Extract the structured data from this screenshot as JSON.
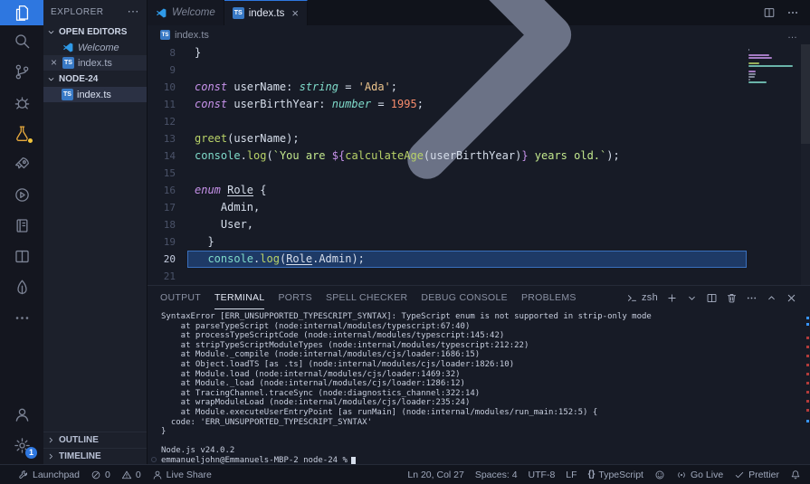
{
  "colors": {
    "accent_blue": "#2e77e0",
    "ts_icon_blue": "#3879c5",
    "flask_orange": "#e8aa3d",
    "badge_yellow": "#f0c33c",
    "error_red": "#b23b3b",
    "info_blue": "#3794ff",
    "selection_blue": "#1e3a66"
  },
  "activity_bar": {
    "top": [
      {
        "name": "explorer",
        "icon": "files",
        "active": true
      },
      {
        "name": "search",
        "icon": "search"
      },
      {
        "name": "source-control",
        "icon": "git-branch"
      },
      {
        "name": "run-debug",
        "icon": "bug"
      },
      {
        "name": "testing",
        "icon": "flask",
        "color": "#e8aa3d",
        "dot": true
      },
      {
        "name": "remote-explorer",
        "icon": "rocket"
      },
      {
        "name": "run",
        "icon": "play-circle"
      },
      {
        "name": "notebook",
        "icon": "book"
      },
      {
        "name": "editor-layout",
        "icon": "columns"
      },
      {
        "name": "mongodb",
        "icon": "leaf"
      },
      {
        "name": "more-views",
        "icon": "ellipsis"
      }
    ],
    "bottom": [
      {
        "name": "accounts",
        "icon": "person"
      },
      {
        "name": "settings",
        "icon": "gear",
        "badge": "1"
      }
    ]
  },
  "sidebar": {
    "title": "EXPLORER",
    "more_actions": "⋯",
    "open_editors": {
      "label": "OPEN EDITORS",
      "items": [
        {
          "label": "Welcome",
          "icon": "vscode",
          "italic": true
        },
        {
          "label": "index.ts",
          "icon": "ts",
          "active": true,
          "close": "×"
        }
      ]
    },
    "folder": {
      "label": "NODE-24",
      "items": [
        {
          "label": "index.ts",
          "icon": "ts",
          "selected": true
        }
      ]
    },
    "bottom_sections": [
      {
        "label": "OUTLINE"
      },
      {
        "label": "TIMELINE"
      }
    ]
  },
  "tab_bar": {
    "tabs": [
      {
        "label": "Welcome",
        "icon": "vscode",
        "italic": true
      },
      {
        "label": "index.ts",
        "icon": "ts",
        "active": true,
        "close": "×"
      }
    ]
  },
  "breadcrumb": {
    "file": "index.ts",
    "ellipsis": "…"
  },
  "editor": {
    "lines": [
      {
        "n": "8",
        "tokens": [
          [
            "fg",
            "}"
          ]
        ]
      },
      {
        "n": "9",
        "tokens": []
      },
      {
        "n": "10",
        "tokens": [
          [
            "kw",
            "const "
          ],
          [
            "vr",
            "userName"
          ],
          [
            "fg",
            ": "
          ],
          [
            "ty",
            "string"
          ],
          [
            "fg",
            " = "
          ],
          [
            "st",
            "'Ada'"
          ],
          [
            "fg",
            ";"
          ]
        ]
      },
      {
        "n": "11",
        "tokens": [
          [
            "kw",
            "const "
          ],
          [
            "vr",
            "userBirthYear"
          ],
          [
            "fg",
            ": "
          ],
          [
            "ty",
            "number"
          ],
          [
            "fg",
            " = "
          ],
          [
            "nu",
            "1995"
          ],
          [
            "fg",
            ";"
          ]
        ]
      },
      {
        "n": "12",
        "tokens": []
      },
      {
        "n": "13",
        "tokens": [
          [
            "fn",
            "greet"
          ],
          [
            "fg",
            "("
          ],
          [
            "vr",
            "userName"
          ],
          [
            "fg",
            ");"
          ]
        ]
      },
      {
        "n": "14",
        "tokens": [
          [
            "ob",
            "console"
          ],
          [
            "fg",
            "."
          ],
          [
            "fn",
            "log"
          ],
          [
            "fg",
            "("
          ],
          [
            "st2",
            "`You are "
          ],
          [
            "kw2",
            "${"
          ],
          [
            "fn",
            "calculateAge"
          ],
          [
            "fg",
            "("
          ],
          [
            "vr",
            "userBirthYear"
          ],
          [
            "fg",
            ")"
          ],
          [
            "kw2",
            "}"
          ],
          [
            "st2",
            " years old.`"
          ],
          [
            "fg",
            ");"
          ]
        ]
      },
      {
        "n": "15",
        "tokens": []
      },
      {
        "n": "16",
        "tokens": [
          [
            "kw",
            "enum "
          ],
          [
            "clu",
            "Role"
          ],
          [
            "fg",
            " {"
          ]
        ]
      },
      {
        "n": "17",
        "tokens": [
          [
            "fg",
            "    Admin,"
          ]
        ]
      },
      {
        "n": "18",
        "tokens": [
          [
            "fg",
            "    User,"
          ]
        ]
      },
      {
        "n": "19",
        "tokens": [
          [
            "fg",
            "  }"
          ]
        ]
      },
      {
        "n": "20",
        "selected": true,
        "tokens": [
          [
            "fg",
            "  "
          ],
          [
            "ob",
            "console"
          ],
          [
            "fg",
            "."
          ],
          [
            "fn",
            "log"
          ],
          [
            "fg",
            "("
          ],
          [
            "clu",
            "Role"
          ],
          [
            "fg",
            "."
          ],
          [
            "en",
            "Admin"
          ],
          [
            "fg",
            ");"
          ]
        ]
      },
      {
        "n": "21",
        "tokens": []
      }
    ]
  },
  "panel": {
    "tabs": [
      {
        "label": "OUTPUT"
      },
      {
        "label": "TERMINAL",
        "active": true
      },
      {
        "label": "PORTS"
      },
      {
        "label": "SPELL CHECKER"
      },
      {
        "label": "DEBUG CONSOLE"
      },
      {
        "label": "PROBLEMS"
      }
    ],
    "shell": "zsh",
    "terminal_lines": [
      "SyntaxError [ERR_UNSUPPORTED_TYPESCRIPT_SYNTAX]: TypeScript enum is not supported in strip-only mode",
      "    at parseTypeScript (node:internal/modules/typescript:67:40)",
      "    at processTypeScriptCode (node:internal/modules/typescript:145:42)",
      "    at stripTypeScriptModuleTypes (node:internal/modules/typescript:212:22)",
      "    at Module._compile (node:internal/modules/cjs/loader:1686:15)",
      "    at Object.loadTS [as .ts] (node:internal/modules/cjs/loader:1826:10)",
      "    at Module.load (node:internal/modules/cjs/loader:1469:32)",
      "    at Module._load (node:internal/modules/cjs/loader:1286:12)",
      "    at TracingChannel.traceSync (node:diagnostics_channel:322:14)",
      "    at wrapModuleLoad (node:internal/modules/cjs/loader:235:24)",
      "    at Module.executeUserEntryPoint [as runMain] (node:internal/modules/run_main:152:5) {",
      "  code: 'ERR_UNSUPPORTED_TYPESCRIPT_SYNTAX'",
      "}",
      "",
      "Node.js v24.0.2"
    ],
    "prompt": "emmanueljohn@Emmanuels-MBP-2 node-24 %"
  },
  "status_bar": {
    "left": [
      {
        "name": "launchpad",
        "icon": "tools",
        "label": "Launchpad"
      },
      {
        "name": "errors",
        "icon": "error",
        "label": "0"
      },
      {
        "name": "warnings",
        "icon": "warning",
        "label": "0"
      },
      {
        "name": "live-share",
        "icon": "person",
        "label": "Live Share"
      }
    ],
    "right": [
      {
        "name": "cursor-position",
        "label": "Ln 20, Col 27"
      },
      {
        "name": "indentation",
        "label": "Spaces: 4"
      },
      {
        "name": "encoding",
        "label": "UTF-8"
      },
      {
        "name": "eol",
        "label": "LF"
      },
      {
        "name": "language-mode",
        "icon": "braces",
        "label": "TypeScript"
      },
      {
        "name": "feedback",
        "icon": "smiley",
        "label": ""
      },
      {
        "name": "go-live",
        "icon": "broadcast",
        "label": "Go Live"
      },
      {
        "name": "prettier",
        "icon": "check",
        "label": "Prettier"
      },
      {
        "name": "notifications",
        "icon": "bell",
        "label": ""
      }
    ]
  }
}
